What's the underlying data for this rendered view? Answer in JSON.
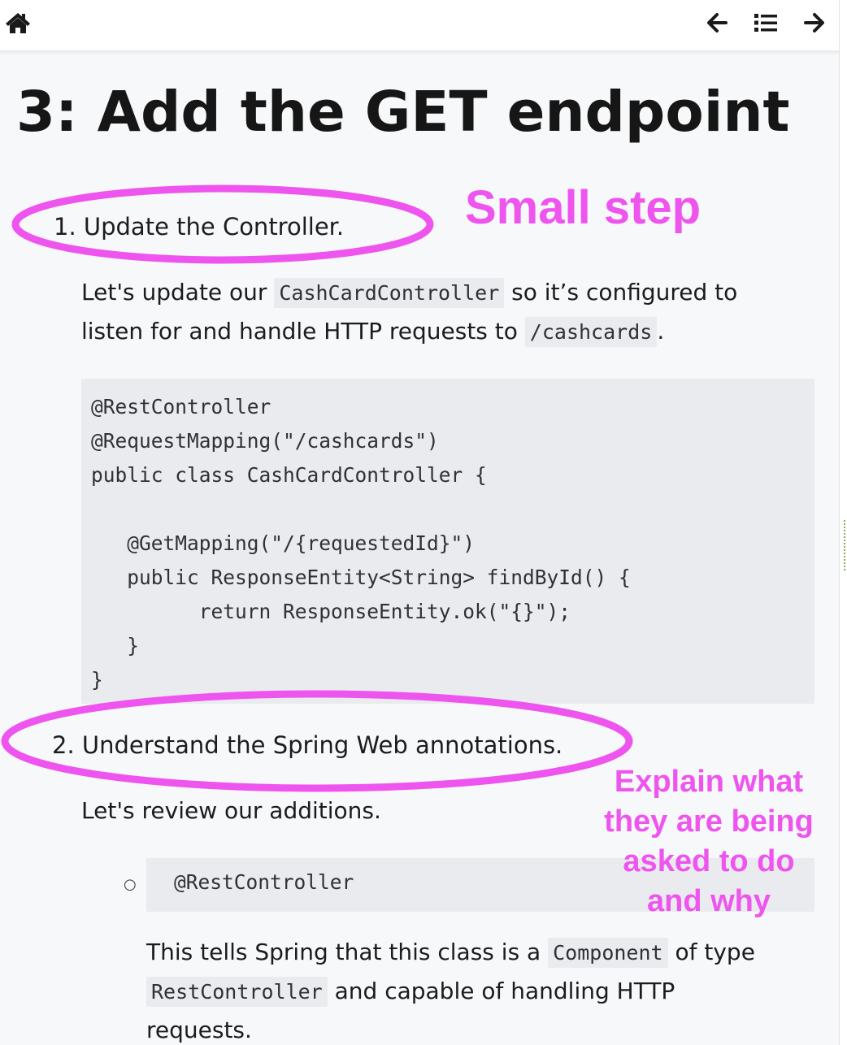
{
  "nav": {
    "home_icon": "home-icon",
    "prev_icon": "arrow-left-icon",
    "toc_icon": "list-icon",
    "next_icon": "arrow-right-icon"
  },
  "page": {
    "title": "3: Add the GET endpoint"
  },
  "steps": [
    {
      "label": "1. Update the Controller.",
      "para_line1_a": "Let's update our ",
      "para_line1_code": "CashCardController",
      "para_line1_b": " so it’s configured to",
      "para_line2_a": "listen for and handle HTTP requests to ",
      "para_line2_code": "/cashcards",
      "para_line2_b": ".",
      "code": "@RestController\n@RequestMapping(\"/cashcards\")\npublic class CashCardController {\n\n   @GetMapping(\"/{requestedId}\")\n   public ResponseEntity<String> findById() {\n         return ResponseEntity.ok(\"{}\");\n   }\n}"
    },
    {
      "label": "2. Understand the Spring Web annotations.",
      "para": "Let's review our additions.",
      "bullet_marker": "○",
      "bullet_code": "@RestController",
      "desc_line1_a": "This tells Spring that this class is a ",
      "desc_line1_code": "Component",
      "desc_line1_b": " of type",
      "desc_line2_code": "RestController",
      "desc_line2_b": " and capable of handling HTTP",
      "desc_line3": "requests."
    }
  ],
  "annotations": {
    "color": "#ee55ee",
    "small_step": "Small step",
    "explain_line1": "Explain what",
    "explain_line2": "they are being",
    "explain_line3": "asked to do",
    "explain_line4": "and why"
  }
}
